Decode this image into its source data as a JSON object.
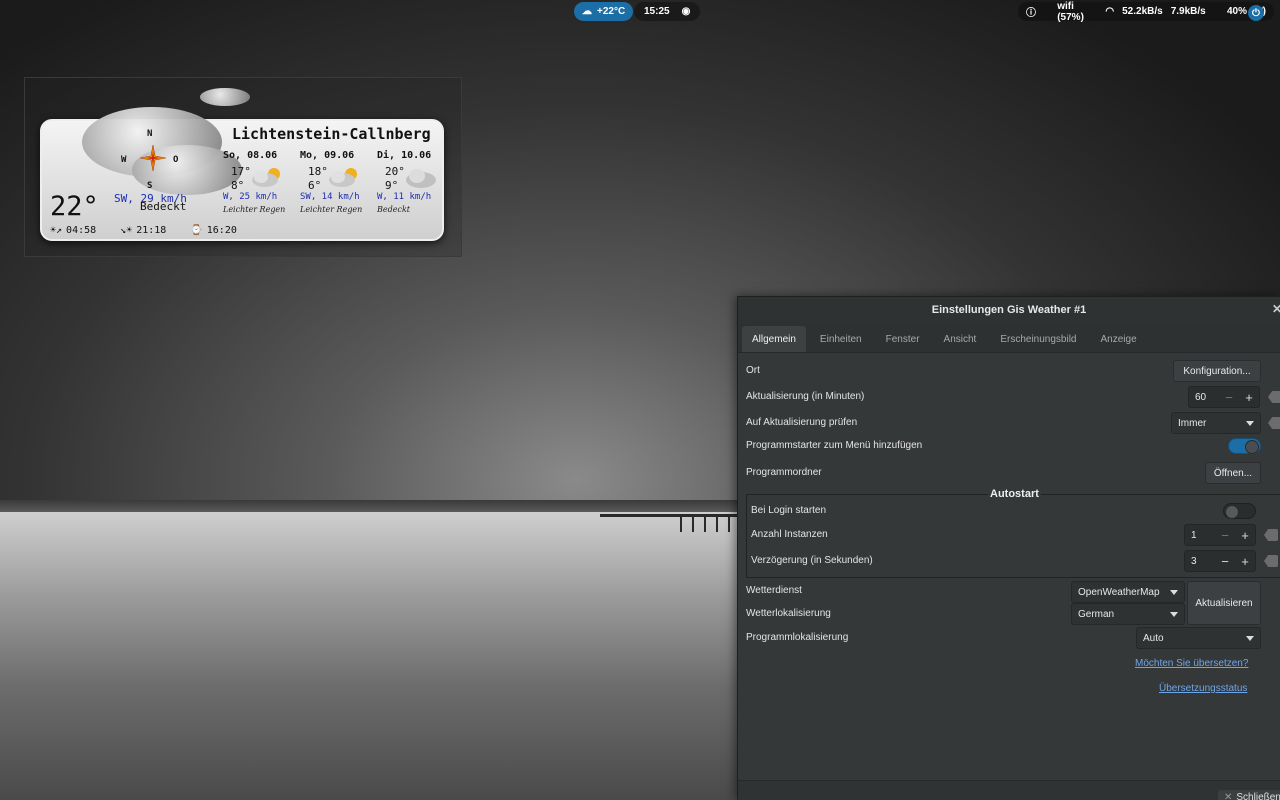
{
  "panel": {
    "weather": "+22°C",
    "clock": "15:25",
    "wifi": "wifi (57%)",
    "down": "52.2kB/s",
    "up": "7.9kB/s",
    "battery": "40%"
  },
  "desklet": {
    "city": "Lichtenstein-Callnberg",
    "compass": {
      "n": "N",
      "w": "W",
      "o": "O",
      "s": "S"
    },
    "temp": "22°",
    "wind": "SW, 29 km/h",
    "condition": "Bedeckt",
    "forecast": [
      {
        "day": "So, 08.06",
        "hi": "17°",
        "lo": "8°",
        "wind": "W, 25 km/h",
        "cond": "Leichter Regen"
      },
      {
        "day": "Mo, 09.06",
        "hi": "18°",
        "lo": "6°",
        "wind": "SW, 14 km/h",
        "cond": "Leichter Regen"
      },
      {
        "day": "Di, 10.06",
        "hi": "20°",
        "lo": "9°",
        "wind": "W, 11 km/h",
        "cond": "Bedeckt"
      }
    ],
    "sunrise": "04:58",
    "sunset": "21:18",
    "daylength": "16:20"
  },
  "window": {
    "title": "Einstellungen Gis Weather #1",
    "tabs": [
      "Allgemein",
      "Einheiten",
      "Fenster",
      "Ansicht",
      "Erscheinungsbild",
      "Anzeige"
    ],
    "ort_label": "Ort",
    "ort_button": "Konfiguration...",
    "update_label": "Aktualisierung (in Minuten)",
    "update_value": "60",
    "check_label": "Auf Aktualisierung prüfen",
    "check_value": "Immer",
    "menu_label": "Programmstarter zum Menü hinzufügen",
    "folder_label": "Programmordner",
    "folder_button": "Öffnen...",
    "autostart_title": "Autostart",
    "login_label": "Bei Login starten",
    "instances_label": "Anzahl Instanzen",
    "instances_value": "1",
    "delay_label": "Verzögerung (in Sekunden)",
    "delay_value": "3",
    "service_label": "Wetterdienst",
    "service_value": "OpenWeatherMap",
    "wlocal_label": "Wetterlokalisierung",
    "wlocal_value": "German",
    "refresh_button": "Aktualisieren",
    "plocal_label": "Programmlokalisierung",
    "plocal_value": "Auto",
    "translate_link": "Möchten Sie übersetzen?",
    "status_link": "Übersetzungsstatus",
    "close_button": "Schließen"
  },
  "colors": {
    "accent": "#1c6ea6",
    "toggle_on": "#1c6ea6",
    "link": "#6ea5ea"
  }
}
